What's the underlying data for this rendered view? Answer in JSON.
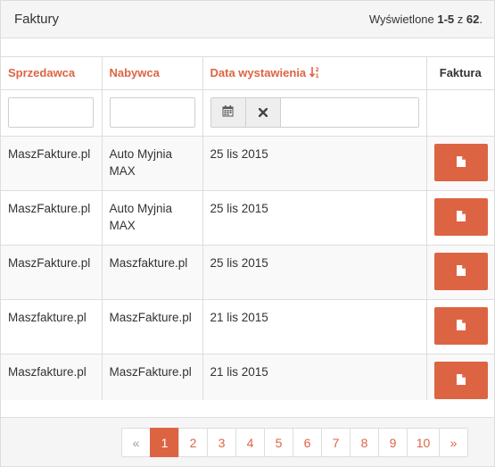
{
  "header": {
    "title": "Faktury",
    "count_prefix": "Wyświetlone ",
    "count_range": "1-5",
    "count_middle": " z ",
    "count_total": "62",
    "count_suffix": "."
  },
  "columns": {
    "seller": "Sprzedawca",
    "buyer": "Nabywca",
    "date": "Data wystawienia",
    "invoice": "Faktura"
  },
  "filters": {
    "calendar_icon": "calendar-icon",
    "clear_icon": "times-icon"
  },
  "rows": [
    {
      "seller": "MaszFakture.pl",
      "buyer": "Auto Myjnia MAX",
      "date": "25 lis 2015"
    },
    {
      "seller": "MaszFakture.pl",
      "buyer": "Auto Myjnia MAX",
      "date": "25 lis 2015"
    },
    {
      "seller": "MaszFakture.pl",
      "buyer": "Maszfakture.pl",
      "date": "25 lis 2015"
    },
    {
      "seller": "Maszfakture.pl",
      "buyer": "MaszFakture.pl",
      "date": "21 lis 2015"
    },
    {
      "seller": "Maszfakture.pl",
      "buyer": "MaszFakture.pl",
      "date": "21 lis 2015"
    }
  ],
  "pagination": {
    "prev": "«",
    "pages": [
      "1",
      "2",
      "3",
      "4",
      "5",
      "6",
      "7",
      "8",
      "9",
      "10"
    ],
    "next": "»",
    "current": "1"
  },
  "colors": {
    "accent": "#dd6443",
    "header_bg": "#f5f5f5",
    "border": "#dddddd"
  }
}
